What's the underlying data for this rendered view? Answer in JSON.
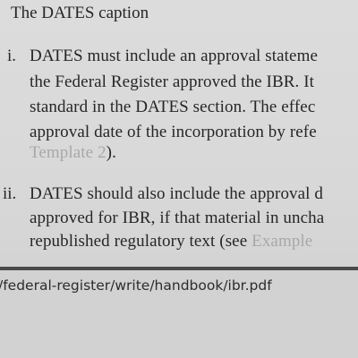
{
  "document": {
    "heading_bullet": ".",
    "heading": "The DATES caption",
    "items": [
      {
        "numeral": "i.",
        "lines": [
          "DATES must include an approval stateme",
          "the Federal Register approved the IBR.  It",
          "standard in the DATES section.  The effec",
          "approval date of the incorporation by refe"
        ],
        "last_line_link": "Template 2",
        "last_line_tail": ")."
      },
      {
        "numeral": "ii.",
        "lines": [
          "DATES should also include the approval d",
          "approved for IBR, if that material in uncha"
        ],
        "last_line_prefix": "republished regulatory text (see ",
        "last_line_link": "Example"
      }
    ]
  },
  "footer": {
    "url": "/federal-register/write/handbook/ibr.pdf"
  }
}
